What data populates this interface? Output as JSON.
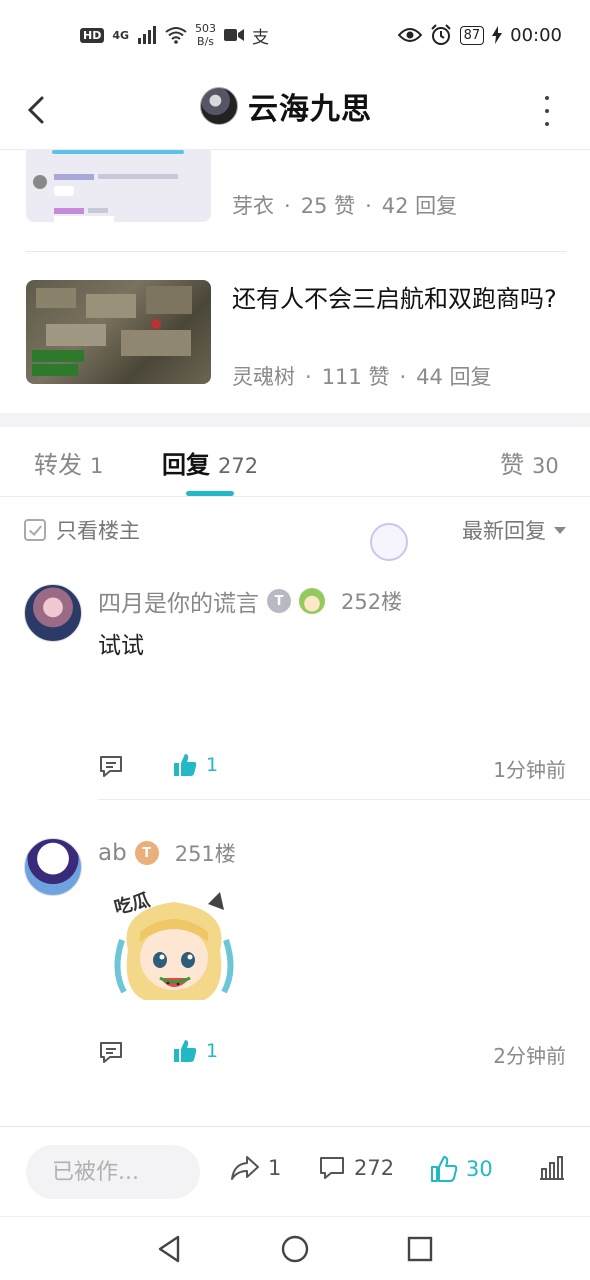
{
  "statusbar": {
    "hd": "HD",
    "net": "4G",
    "speed_top": "503",
    "speed_bottom": "B/s",
    "battery": "87",
    "time": "00:00"
  },
  "header": {
    "title": "云海九思"
  },
  "related": [
    {
      "author": "芽衣",
      "likes": "25 赞",
      "replies": "42 回复"
    },
    {
      "title": "还有人不会三启航和双跑商吗?",
      "author": "灵魂树",
      "likes": "111 赞",
      "replies": "44 回复"
    }
  ],
  "tabs": [
    {
      "label": "转发",
      "count": "1"
    },
    {
      "label": "回复",
      "count": "272"
    },
    {
      "label": "赞",
      "count": "30"
    }
  ],
  "filter": {
    "only_op": "只看楼主",
    "sort": "最新回复"
  },
  "comments": [
    {
      "name": "四月是你的谎言",
      "level": "T",
      "floor": "252楼",
      "text": "试试",
      "likes": "1",
      "time": "1分钟前"
    },
    {
      "name": "ab",
      "level": "T",
      "floor": "251楼",
      "sticker": "吃瓜",
      "likes": "1",
      "time": "2分钟前"
    }
  ],
  "bottombar": {
    "input_placeholder": "已被作...",
    "share_count": "1",
    "reply_count": "272",
    "like_count": "30"
  },
  "colors": {
    "accent": "#22b8c5"
  }
}
